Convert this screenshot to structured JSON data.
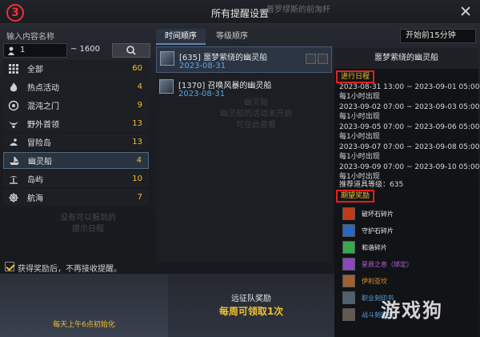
{
  "header": {
    "title": "所有提醒设置",
    "ghost": "普罗缪斯的前淘杆",
    "step_badge": "3"
  },
  "left": {
    "input_label": "输入内容名称",
    "range_min": "1",
    "range_max": "~ 1600",
    "categories": [
      {
        "label": "全部",
        "count": "60",
        "icon": "grid-icon"
      },
      {
        "label": "热点活动",
        "count": "4",
        "icon": "fire-icon"
      },
      {
        "label": "混沌之门",
        "count": "9",
        "icon": "chaos-gate-icon"
      },
      {
        "label": "野外首领",
        "count": "13",
        "icon": "boss-horns-icon"
      },
      {
        "label": "冒险岛",
        "count": "13",
        "icon": "island-map-icon"
      },
      {
        "label": "幽灵船",
        "count": "4",
        "icon": "ghost-ship-icon"
      },
      {
        "label": "岛屿",
        "count": "10",
        "icon": "palm-island-icon"
      },
      {
        "label": "航海",
        "count": "7",
        "icon": "ship-wheel-icon"
      }
    ],
    "empty_hint": "没有可以报到的\n提示日程",
    "checkbox_label": "获得奖励后，不再接收提醒。"
  },
  "tabs": {
    "time_order": "时间顺序",
    "level_order": "等级顺序"
  },
  "select": {
    "value": "开始前15分钟"
  },
  "list": [
    {
      "name": "[635] 噩梦萦绕的幽灵船",
      "date": "2023-08-31"
    },
    {
      "name": "[1370] 召唤风暴的幽灵船",
      "date": "2023-08-31"
    }
  ],
  "ghost_list_text": "幽灵船\n幽灵船的活动未开启\n可在此查看",
  "detail": {
    "title": "噩梦萦绕的幽灵船",
    "schedule_label": "进行日程",
    "schedule": [
      {
        "range": "2023-08-31 13:00 ~ 2023-09-01 05:00",
        "note": "每1小时出现"
      },
      {
        "range": "2023-09-02 07:00 ~ 2023-09-03 05:00",
        "note": "每1小时出现"
      },
      {
        "range": "2023-09-05 07:00 ~ 2023-09-06 05:00",
        "note": "每1小时出现"
      },
      {
        "range": "2023-09-07 07:00 ~ 2023-09-08 05:00",
        "note": "每1小时出现"
      },
      {
        "range": "2023-09-09 07:00 ~ 2023-09-10 05:00",
        "note": "每1小时出现"
      }
    ],
    "required_level": "推荐道具等级：635",
    "reward_label": "期望奖励",
    "rewards": [
      {
        "name": "破坏石碎片",
        "color": "#e8e8e8",
        "icon_color": "#c03a18"
      },
      {
        "name": "守护石碎片",
        "color": "#e8e8e8",
        "icon_color": "#2a66c8"
      },
      {
        "name": "和谐碎片",
        "color": "#e8e8e8",
        "icon_color": "#3aa84a"
      },
      {
        "name": "星辰之息（绑定）",
        "color": "#b060e0",
        "icon_color": "#8a48c0"
      },
      {
        "name": "伊利亚坎",
        "color": "#e89030",
        "icon_color": "#a06030"
      },
      {
        "name": "职业刻印书",
        "color": "#5aa0e0",
        "icon_color": "#506070"
      },
      {
        "name": "战斗刻印书",
        "color": "#5aa0e0",
        "icon_color": "#605a50"
      }
    ]
  },
  "bottom": {
    "reset_text": "每天上午6点初始化",
    "expedition_title": "远征队奖励",
    "expedition_sub": "每周可领取1次"
  },
  "watermark": "游戏狗"
}
